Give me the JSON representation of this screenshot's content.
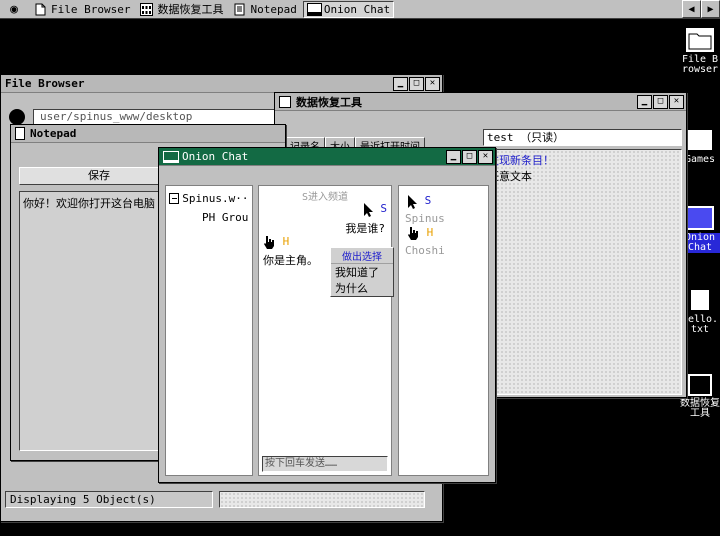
{
  "taskbar": {
    "items": [
      {
        "label": "File Browser"
      },
      {
        "label": "数据恢复工具"
      },
      {
        "label": "Notepad"
      },
      {
        "label": "Onion Chat"
      }
    ]
  },
  "file_browser": {
    "title": "File Browser",
    "path": "user/spinus_www/desktop",
    "status": "Displaying 5 Object(s)"
  },
  "recovery": {
    "title": "数据恢复工具",
    "tabs": [
      "记录名",
      "大小",
      "最近打开时间"
    ],
    "filename": "test （只读）",
    "preview_line1": "发现新条目！",
    "preview_line2": "任意文本"
  },
  "notepad": {
    "title": "Notepad",
    "save_label": "保存",
    "content": "你好！欢迎你打开这台电脑"
  },
  "chat": {
    "title": "Onion Chat",
    "contacts": [
      {
        "name": "Spinus.w···"
      },
      {
        "name": "PH Grou"
      }
    ],
    "messages": {
      "system": "S进入频道",
      "who_am_i": "我是谁?",
      "you_are_protagonist": "你是主角。",
      "sender_s": "S",
      "sender_h": "H"
    },
    "choice": {
      "header": "做出选择",
      "options": [
        "我知道了",
        "为什么"
      ]
    },
    "input_placeholder": "按下回车发送……",
    "members": [
      {
        "label": "S",
        "name": "Spinus"
      },
      {
        "label": "H",
        "name": "Choshi"
      }
    ]
  },
  "desktop_icons": [
    {
      "label": "File Browser"
    },
    {
      "label": "Games"
    },
    {
      "label": "Onion Chat"
    },
    {
      "label": "hello.txt"
    },
    {
      "label": "数据恢复工具"
    }
  ],
  "colors": {
    "chat_titlebar": "#136a44",
    "selection": "#2828d8",
    "sender_blue": "#2020cc",
    "sender_orange": "#e8a000"
  }
}
